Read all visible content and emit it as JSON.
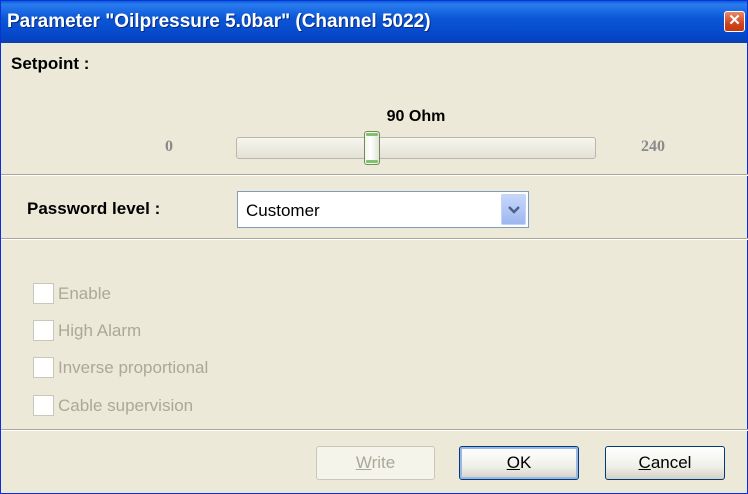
{
  "window": {
    "title": "Parameter \"Oilpressure 5.0bar\" (Channel 5022)",
    "close_glyph": "✕",
    "close_icon": "close-icon"
  },
  "setpoint": {
    "label": "Setpoint :",
    "value_label": "90 Ohm",
    "min_label": "0",
    "max_label": "240",
    "value": 90,
    "min": 0,
    "max": 240
  },
  "password": {
    "label": "Password level :",
    "selected": "Customer",
    "arrow_icon": "chevron-down-icon"
  },
  "checkboxes": [
    {
      "label": "Enable",
      "checked": false,
      "enabled": false
    },
    {
      "label": "High Alarm",
      "checked": false,
      "enabled": false
    },
    {
      "label": "Inverse proportional",
      "checked": false,
      "enabled": false
    },
    {
      "label": "Cable supervision",
      "checked": false,
      "enabled": false
    }
  ],
  "buttons": {
    "write": {
      "mnemonic": "W",
      "rest": "rite",
      "enabled": false
    },
    "ok": {
      "mnemonic": "O",
      "rest": "K",
      "enabled": true
    },
    "cancel": {
      "mnemonic": "C",
      "rest": "ancel",
      "enabled": true
    }
  },
  "colors": {
    "titlebar": "#0a5fd8",
    "dialog_bg": "#ece9d8",
    "disabled_text": "#aca899",
    "thumb_accent": "#7fc36a"
  }
}
